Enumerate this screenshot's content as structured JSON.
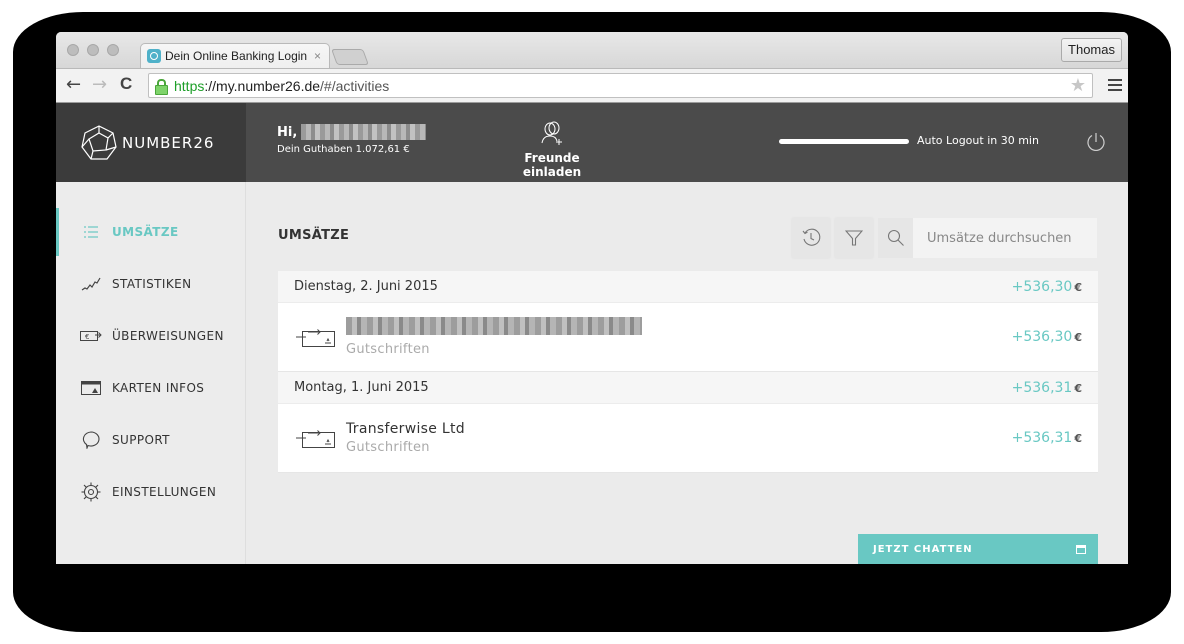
{
  "browser": {
    "tab_title": "Dein Online Banking Login",
    "tab_close": "×",
    "profile_name": "Thomas",
    "url_scheme": "https",
    "url_host": "://my.number26.de",
    "url_path": "/#/activities",
    "back": "←",
    "forward": "→",
    "reload": "C",
    "bookmark_star": "★"
  },
  "header": {
    "brand": "NUMBER26",
    "greeting": "Hi,",
    "balance_text": "Dein Guthaben 1.072,61 €",
    "invite_label": "Freunde einladen",
    "auto_logout_text": "Auto Logout in 30 min",
    "auto_logout_progress": 1.0
  },
  "sidebar": {
    "items": [
      {
        "label": "UMSÄTZE",
        "icon": "list-icon",
        "active": true
      },
      {
        "label": "STATISTIKEN",
        "icon": "chart-line-icon",
        "active": false
      },
      {
        "label": "ÜBERWEISUNGEN",
        "icon": "transfer-icon",
        "active": false
      },
      {
        "label": "KARTEN INFOS",
        "icon": "card-icon",
        "active": false
      },
      {
        "label": "SUPPORT",
        "icon": "speech-bubble-icon",
        "active": false
      },
      {
        "label": "EINSTELLUNGEN",
        "icon": "gear-icon",
        "active": false
      }
    ]
  },
  "main": {
    "title": "UMSÄTZE",
    "search_placeholder": "Umsätze durchsuchen",
    "days": [
      {
        "date": "Dienstag, 2. Juni 2015",
        "total": "+536,30",
        "currency": "€",
        "transactions": [
          {
            "name": "",
            "name_redacted": true,
            "category": "Gutschriften",
            "amount": "+536,30",
            "currency": "€"
          }
        ]
      },
      {
        "date": "Montag, 1. Juni 2015",
        "total": "+536,31",
        "currency": "€",
        "transactions": [
          {
            "name": "Transferwise Ltd",
            "name_redacted": false,
            "category": "Gutschriften",
            "amount": "+536,31",
            "currency": "€"
          }
        ]
      }
    ],
    "chat_label": "JETZT CHATTEN"
  },
  "colors": {
    "accent": "#69c8c3",
    "header_bg": "#4b4b4b",
    "logo_bg": "#3b3b3b"
  }
}
